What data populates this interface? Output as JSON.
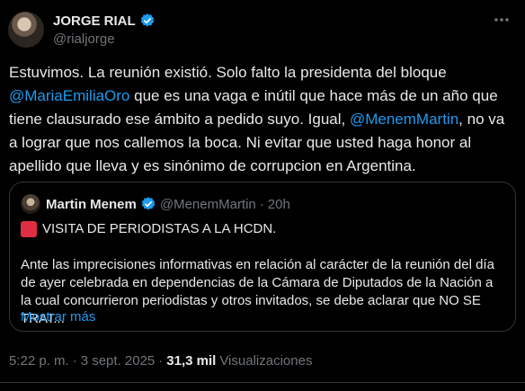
{
  "author": {
    "name": "JORGE RIAL",
    "handle": "@rialjorge"
  },
  "tweet": {
    "text_1": "Estuvimos. La reunión existió. Solo falto la presidenta del bloque ",
    "mention_1": "@MariaEmiliaOro",
    "text_2": " que es una vaga e inútil que hace más de un año que tiene clausurado ese ámbito a pedido suyo. Igual, ",
    "mention_2": "@MenemMartin",
    "text_3": ", no va a lograr que nos callemos la boca. Ni evitar que usted haga honor al apellido que lleva y es sinónimo de corrupcion en Argentina."
  },
  "quote": {
    "name": "Martin Menem",
    "handle": "@MenemMartin",
    "separator": "·",
    "time": "20h",
    "headline": "VISITA DE PERIODISTAS A LA HCDN.",
    "body": "Ante las imprecisiones informativas en relación al carácter de la reunión del día de ayer celebrada en dependencias de la Cámara de Diputados de la Nación a la cual concurrieron periodistas y otros invitados, se debe aclarar que NO SE TRAT...",
    "show_more": "Mostrar más"
  },
  "footer": {
    "time": "5:22 p. m.",
    "separator_1": "·",
    "date": "3 sept. 2025",
    "separator_2": "·",
    "views": "31,3 mil",
    "views_label": "Visualizaciones"
  },
  "colors": {
    "background": "#000000",
    "accent": "#1d9bf0",
    "text": "#e7e9ea",
    "muted": "#71767b",
    "border": "#2f3336"
  }
}
